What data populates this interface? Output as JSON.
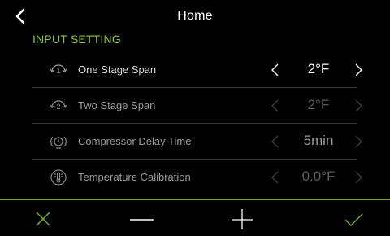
{
  "header": {
    "title": "Home",
    "back_icon": "chevron-left-icon"
  },
  "section": {
    "title": "INPUT SETTING",
    "accent_color": "#8fc43f"
  },
  "rows": [
    {
      "label": "One Stage Span",
      "value": "2°F",
      "icon": "stage-one-icon",
      "active": true
    },
    {
      "label": "Two Stage Span",
      "value": "2°F",
      "icon": "stage-two-icon",
      "active": false
    },
    {
      "label": "Compressor Delay Time",
      "value": "5min",
      "icon": "compressor-icon",
      "active": false
    },
    {
      "label": "Temperature Calibration",
      "value": "0.0°F",
      "icon": "thermometer-icon",
      "active": false
    }
  ],
  "toolbar": {
    "cancel_icon": "close-icon",
    "decrease_icon": "minus-icon",
    "increase_icon": "plus-icon",
    "confirm_icon": "check-icon"
  },
  "colors": {
    "background": "#000000",
    "accent": "#8fc43f",
    "divider": "#3a3a3a"
  }
}
